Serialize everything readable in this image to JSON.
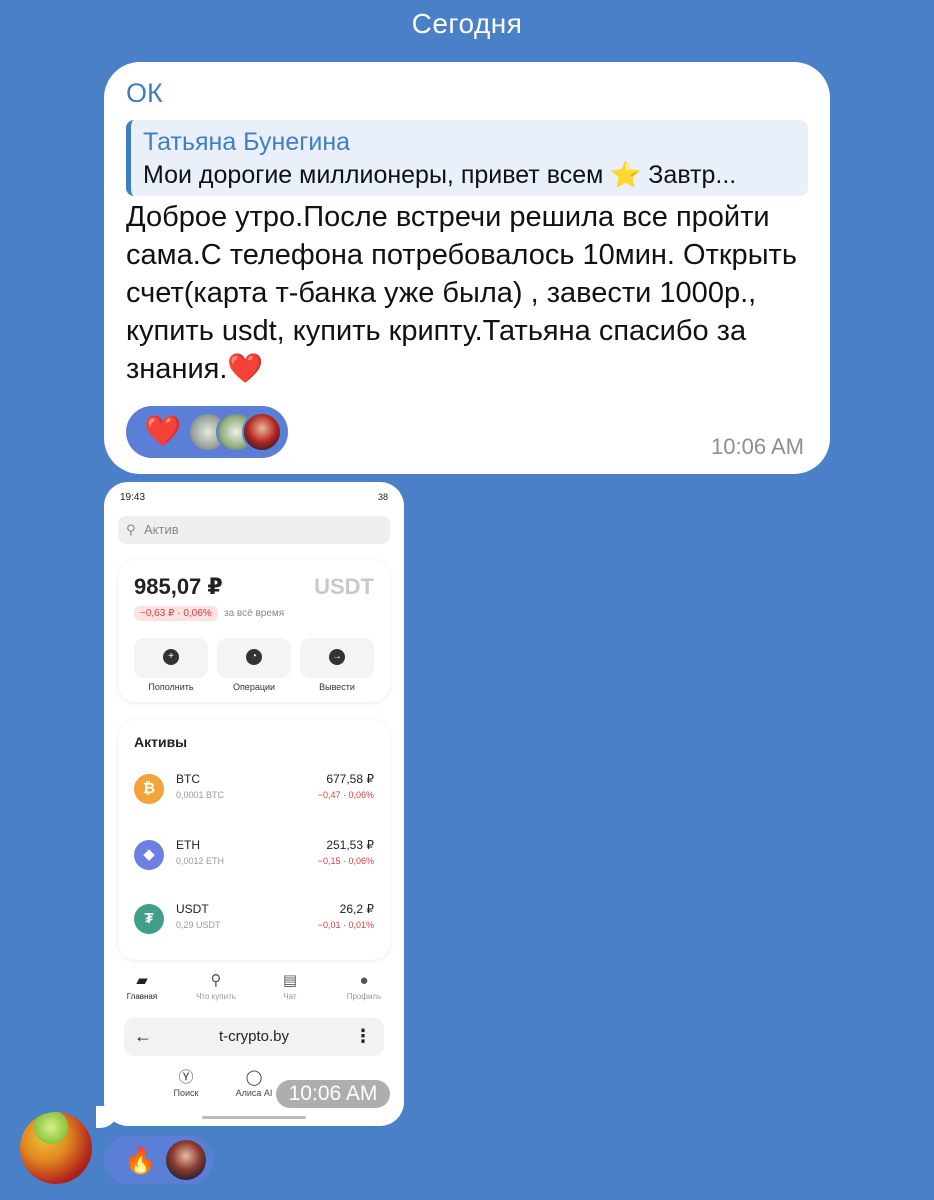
{
  "date_header": "Сегодня",
  "message": {
    "sender": "ОК",
    "reply": {
      "author": "Татьяна Бунегина",
      "text": "Мои дорогие миллионеры, привет всем ⭐  Завтр..."
    },
    "text": "Доброе утро.После встречи решила все пройти сама.С телефона потребовалось 10мин. Открыть счет(карта т-банка уже была) , завести 1000р., купить usdt, купить крипту.Татьяна спасибо за знания.❤️",
    "reaction_emoji": "❤️",
    "time": "10:06 AM"
  },
  "photo_message": {
    "time": "10:06 AM",
    "reaction_emoji": "🔥",
    "screenshot": {
      "status_time": "19:43",
      "status_right": "38",
      "search_placeholder": "Актив",
      "balance": "985,07 ₽",
      "currency": "USDT",
      "change": "−0,63 ₽ · 0,06%",
      "change_period": "за всё время",
      "actions": [
        {
          "label": "Пополнить",
          "icon": "plus-icon"
        },
        {
          "label": "Операции",
          "icon": "clock-icon"
        },
        {
          "label": "Вывести",
          "icon": "arrow-right-icon"
        }
      ],
      "assets_title": "Активы",
      "assets": [
        {
          "name": "BTC",
          "amount": "0,0001 BTC",
          "value": "677,58 ₽",
          "change": "−0,47 · 0,06%",
          "color": "#f2a33a",
          "symbol": "₿"
        },
        {
          "name": "ETH",
          "amount": "0,0012 ETH",
          "value": "251,53 ₽",
          "change": "−0,15 · 0,06%",
          "color": "#6d7fe0",
          "symbol": "◆"
        },
        {
          "name": "USDT",
          "amount": "0,29 USDT",
          "value": "26,2 ₽",
          "change": "−0,01 · 0,01%",
          "color": "#3f9f8a",
          "symbol": "₮"
        }
      ],
      "nav": [
        {
          "label": "Главная",
          "icon": "briefcase-icon"
        },
        {
          "label": "Что купить",
          "icon": "search-icon"
        },
        {
          "label": "Чат",
          "icon": "chat-icon"
        },
        {
          "label": "Профиль",
          "icon": "profile-icon"
        }
      ],
      "browser_url": "t-crypto.by",
      "browser_tabs": [
        {
          "label": "Поиск",
          "icon": "yandex-icon"
        },
        {
          "label": "Алиса AI",
          "icon": "alice-icon"
        }
      ]
    }
  }
}
